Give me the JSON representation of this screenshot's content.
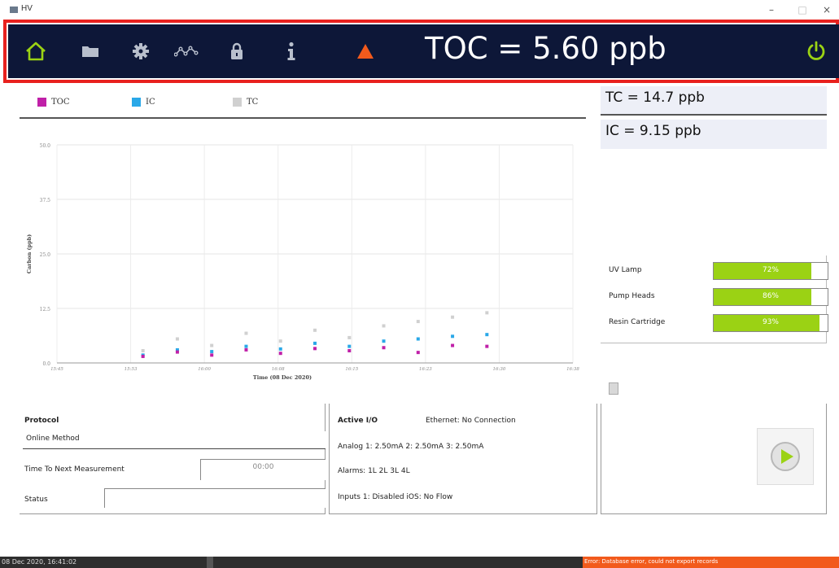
{
  "window": {
    "title": "HV",
    "minimize": "–",
    "maximize": "□",
    "close": "×"
  },
  "header": {
    "toc_reading": "TOC = 5.60 ppb",
    "icons": [
      "home-icon",
      "folder-icon",
      "gear-icon",
      "trend-icon",
      "lock-icon",
      "info-icon",
      "warning-icon",
      "power-icon"
    ],
    "colors": {
      "background": "#0d1738",
      "accent_green": "#9bd214",
      "warning": "#f25a1c",
      "frame": "#e8211e"
    }
  },
  "legend": [
    {
      "label": "TOC",
      "color": "#c020a8"
    },
    {
      "label": "IC",
      "color": "#2aa8e8"
    },
    {
      "label": "TC",
      "color": "#d0d0d0"
    }
  ],
  "readings": {
    "tc": "TC = 14.7 ppb",
    "ic": "IC = 9.15 ppb"
  },
  "consumables": [
    {
      "label": "UV Lamp",
      "percent_text": "72%",
      "value": 0.86
    },
    {
      "label": "Pump Heads",
      "percent_text": "86%",
      "value": 0.86
    },
    {
      "label": "Resin Cartridge",
      "percent_text": "93%",
      "value": 0.93
    }
  ],
  "protocol": {
    "heading": "Protocol",
    "method": "Online Method",
    "time_label": "Time To Next Measurement",
    "time_value": "00:00",
    "status_label": "Status",
    "status_value": ""
  },
  "active_io": {
    "heading": "Active I/O",
    "ethernet": "Ethernet: No Connection",
    "analog": "Analog 1: 2.50mA  2: 2.50mA  3: 2.50mA",
    "alarms": "Alarms: 1L 2L 3L 4L",
    "inputs": "Inputs 1: Disabled  iOS: No Flow"
  },
  "statusbar": {
    "datetime": "08 Dec 2020, 16:41:02",
    "error": "Error: Database error, could not export records"
  },
  "chart_data": {
    "type": "scatter",
    "xlabel": "Time (08 Dec 2020)",
    "ylabel": "Carbon (ppb)",
    "x_ticks": [
      "15:45",
      "15:53",
      "16:00",
      "16:08",
      "16:15",
      "16:23",
      "16:30",
      "16:38"
    ],
    "y_ticks": [
      "0.0",
      "12.5",
      "25.0",
      "37.5",
      "50.0"
    ],
    "ylim": [
      0,
      50
    ],
    "x_domain_minutes": [
      0,
      60
    ],
    "series": [
      {
        "name": "TOC",
        "color": "#c020a8",
        "x": [
          10,
          14,
          18,
          22,
          26,
          30,
          34,
          38,
          42,
          46,
          50
        ],
        "y": [
          1.5,
          2.5,
          1.8,
          3.0,
          2.2,
          3.3,
          2.8,
          3.5,
          2.4,
          4.0,
          3.8
        ]
      },
      {
        "name": "IC",
        "color": "#2aa8e8",
        "x": [
          10,
          14,
          18,
          22,
          26,
          30,
          34,
          38,
          42,
          46,
          50
        ],
        "y": [
          1.8,
          3.0,
          2.6,
          3.8,
          3.2,
          4.5,
          3.8,
          5.0,
          5.5,
          6.1,
          6.5
        ]
      },
      {
        "name": "TC",
        "color": "#d0d0d0",
        "x": [
          10,
          14,
          18,
          22,
          26,
          30,
          34,
          38,
          42,
          46,
          50
        ],
        "y": [
          2.8,
          5.5,
          4.0,
          6.8,
          5.0,
          7.5,
          5.8,
          8.5,
          9.5,
          10.5,
          11.5
        ]
      }
    ]
  }
}
